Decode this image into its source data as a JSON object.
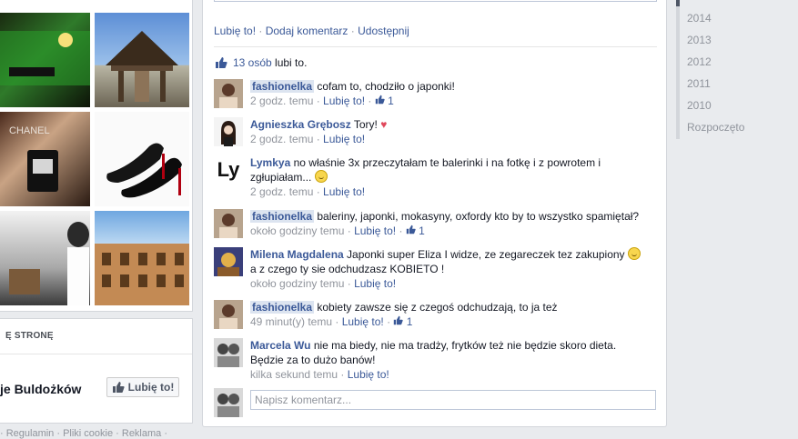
{
  "left": {
    "like_card_title": "Ę STRONĘ",
    "page_name": "je Buldożków",
    "like_button": "Lubię to!",
    "footer": "· Regulamin · Pliki cookie · Reklama ·"
  },
  "post": {
    "actions": [
      "Lubię to!",
      "Dodaj komentarz",
      "Udostępnij"
    ],
    "likes_count": "13 osób",
    "likes_suffix": "lubi to.",
    "comments": [
      {
        "author": "fashionelka",
        "text": "cofam to, chodziło o japonki!",
        "time": "2 godz. temu",
        "like": "Lubię to!",
        "likes": "1",
        "highlight": true
      },
      {
        "author": "Agnieszka Grębosz",
        "text": "Tory!",
        "time": "2 godz. temu",
        "like": "Lubię to!",
        "heart": "♥"
      },
      {
        "author": "Lymkya",
        "avatar_text": "Ly",
        "text": "no właśnie 3x przeczytałam te balerinki i na fotkę i z powrotem i zgłupiałam...",
        "time": "2 godz. temu",
        "like": "Lubię to!"
      },
      {
        "author": "fashionelka",
        "text": "baleriny, japonki, mokasyny, oxfordy kto by to wszystko spamiętał?",
        "time": "około godziny temu",
        "like": "Lubię to!",
        "likes": "1",
        "highlight": true
      },
      {
        "author": "Milena Magdalena",
        "text": "Japonki super Eliza I widze, ze zegareczek tez zakupiony",
        "text2": "a z czego ty sie odchudzasz KOBIETO !",
        "time": "około godziny temu",
        "like": "Lubię to!"
      },
      {
        "author": "fashionelka",
        "text": "kobiety zawsze się z czegoś odchudzają, to ja też",
        "time": "49 minut(y) temu",
        "like": "Lubię to!",
        "likes": "1",
        "highlight": true
      },
      {
        "author": "Marcela Wu",
        "text": "nie ma biedy, nie ma tradży, frytków też nie będzie skoro dieta.",
        "text2": "Będzie za to dużo banów!",
        "time": "kilka sekund temu",
        "like": "Lubię to!"
      }
    ],
    "write_placeholder": "Napisz komentarz..."
  },
  "years": [
    "2014",
    "2013",
    "2012",
    "2011",
    "2010",
    "Rozpoczęto"
  ],
  "colors": {
    "link": "#3b5998",
    "meta": "#90949c",
    "background": "#e9ebee",
    "heart": "#e0485b"
  },
  "icons": {
    "thumb": "thumbs-up-icon",
    "heart": "heart-icon",
    "smile": "smile-emoji-icon"
  }
}
